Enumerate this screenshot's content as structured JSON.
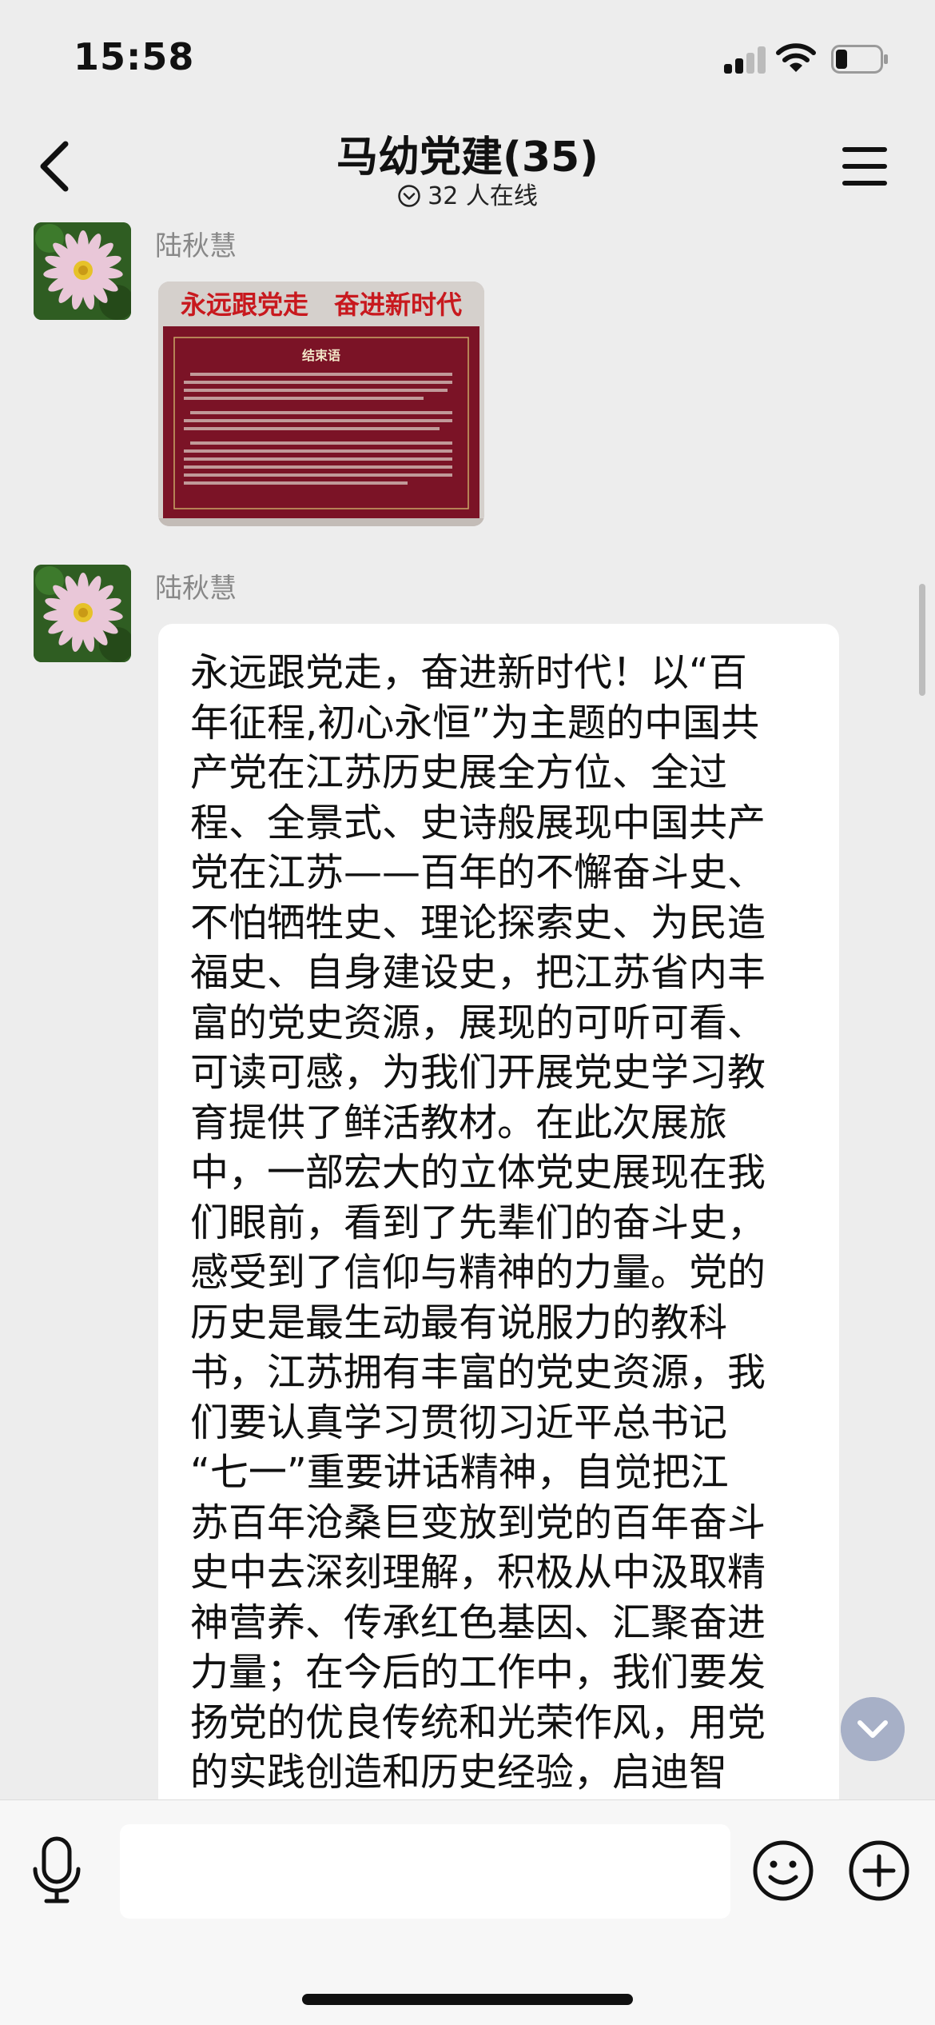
{
  "status_bar": {
    "time": "15:58"
  },
  "header": {
    "title": "马幼党建(35)",
    "online": "32 人在线"
  },
  "messages": [
    {
      "sender": "陆秋慧",
      "type": "image",
      "image_banner": "永远跟党走　奋进新时代",
      "image_heading": "结束语"
    },
    {
      "sender": "陆秋慧",
      "type": "text",
      "lines": [
        "永远跟党走，奋进新时代！以“百",
        "年征程,初心永恒”为主题的中国共",
        "产党在江苏历史展全方位、全过",
        "程、全景式、史诗般展现中国共产",
        "党在江苏——百年的不懈奋斗史、",
        "不怕牺牲史、理论探索史、为民造",
        "福史、自身建设史，把江苏省内丰",
        "富的党史资源，展现的可听可看、",
        "可读可感，为我们开展党史学习教",
        "育提供了鲜活教材。在此次展旅",
        "中，一部宏大的立体党史展现在我",
        "们眼前，看到了先辈们的奋斗史，",
        "感受到了信仰与精神的力量。党的",
        "历史是最生动最有说服力的教科",
        "书，江苏拥有丰富的党史资源，我",
        "们要认真学习贯彻习近平总书记",
        "“七一”重要讲话精神，自觉把江",
        "苏百年沧桑巨变放到党的百年奋斗",
        "史中去深刻理解，积极从中汲取精",
        "神营养、传承红色基因、汇聚奋进",
        "力量；在今后的工作中，我们要发",
        "扬党的优良传统和光荣作风，用党",
        "的实践创造和历史经验，启迪智"
      ]
    }
  ],
  "input_bar": {
    "placeholder": ""
  },
  "icons": {
    "back": "chevron-left-icon",
    "menu": "hamburger-menu-icon",
    "online": "chevron-down-circle-icon",
    "voice": "microphone-icon",
    "emoji": "smiley-icon",
    "add": "plus-circle-icon",
    "scroll_down": "chevron-down-icon"
  },
  "colors": {
    "background": "#ededed",
    "bubble": "#ffffff",
    "sender_name": "#888888",
    "scroll_button": "#a7b0c7",
    "image_banner_text": "#c8191e"
  }
}
